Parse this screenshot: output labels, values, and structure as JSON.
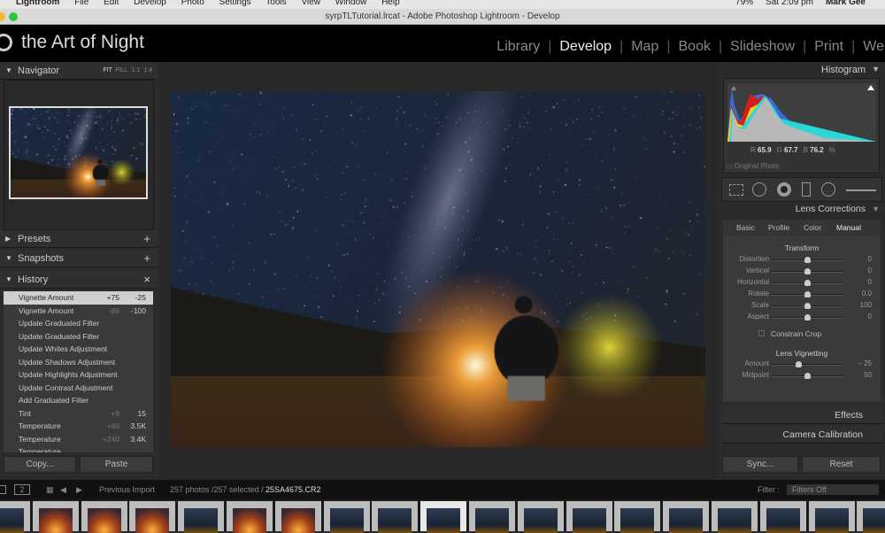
{
  "menubar": {
    "app": "Lightroom",
    "items": [
      "File",
      "Edit",
      "Develop",
      "Photo",
      "Settings",
      "Tools",
      "View",
      "Window",
      "Help"
    ],
    "battery": "79%",
    "clock": "Sat 2:09 pm",
    "user": "Mark Gee"
  },
  "window": {
    "title": "syrpTLTutorial.lrcat - Adobe Photoshop Lightroom - Develop"
  },
  "identity": {
    "plate": "the Art of Night",
    "modules": [
      "Library",
      "Develop",
      "Map",
      "Book",
      "Slideshow",
      "Print",
      "We"
    ],
    "active_module": "Develop"
  },
  "left": {
    "navigator": {
      "title": "Navigator",
      "zoom_options": [
        "FIT",
        "FILL",
        "1:1",
        "1:4"
      ]
    },
    "presets": "Presets",
    "snapshots": "Snapshots",
    "history_title": "History",
    "history": [
      {
        "label": "Vignette Amount",
        "a": "+75",
        "b": "-25",
        "selected": true
      },
      {
        "label": "Vignette Amount",
        "a": "-89",
        "b": "-100"
      },
      {
        "label": "Update Graduated Filter",
        "a": "",
        "b": ""
      },
      {
        "label": "Update Graduated Filter",
        "a": "",
        "b": ""
      },
      {
        "label": "Update Whites Adjustment",
        "a": "",
        "b": ""
      },
      {
        "label": "Update Shadows Adjustment",
        "a": "",
        "b": ""
      },
      {
        "label": "Update Highlights Adjustment",
        "a": "",
        "b": ""
      },
      {
        "label": "Update Contrast Adjustment",
        "a": "",
        "b": ""
      },
      {
        "label": "Add Graduated Filter",
        "a": "",
        "b": ""
      },
      {
        "label": "Tint",
        "a": "+9",
        "b": "15"
      },
      {
        "label": "Temperature",
        "a": "+60",
        "b": "3.5K"
      },
      {
        "label": "Temperature",
        "a": "+240",
        "b": "3.4K"
      },
      {
        "label": "Temperature",
        "a": "",
        "b": ""
      }
    ],
    "copy": "Copy...",
    "paste": "Paste"
  },
  "right": {
    "histogram": {
      "title": "Histogram",
      "r": "65.9",
      "g": "67.7",
      "b": "76.2",
      "unit": "%",
      "original_photo": "Original Photo"
    },
    "lens": {
      "title": "Lens Corrections",
      "tabs": [
        "Basic",
        "Profile",
        "Color",
        "Manual"
      ],
      "active_tab": "Manual",
      "transform_title": "Transform",
      "transform": [
        {
          "label": "Distortion",
          "value": "0",
          "pos": 0.5
        },
        {
          "label": "Vertical",
          "value": "0",
          "pos": 0.5
        },
        {
          "label": "Horizontal",
          "value": "0",
          "pos": 0.5
        },
        {
          "label": "Rotate",
          "value": "0.0",
          "pos": 0.5
        },
        {
          "label": "Scale",
          "value": "100",
          "pos": 0.5
        },
        {
          "label": "Aspect",
          "value": "0",
          "pos": 0.5
        }
      ],
      "constrain": "Constrain Crop",
      "vignetting_title": "Lens Vignetting",
      "vignetting": [
        {
          "label": "Amount",
          "value": "– 25",
          "pos": 0.38
        },
        {
          "label": "Midpoint",
          "value": "50",
          "pos": 0.5
        }
      ]
    },
    "effects": "Effects",
    "calibration": "Camera Calibration",
    "sync": "Sync...",
    "reset": "Reset"
  },
  "filmstrip": {
    "pages": [
      "1",
      "2"
    ],
    "source": "Previous Import",
    "count": "257 photos /257 selected /",
    "file": "25SA4675.CR2",
    "filter_label": "Filter :",
    "filter_value": "Filters Off",
    "selected_index": 9
  }
}
